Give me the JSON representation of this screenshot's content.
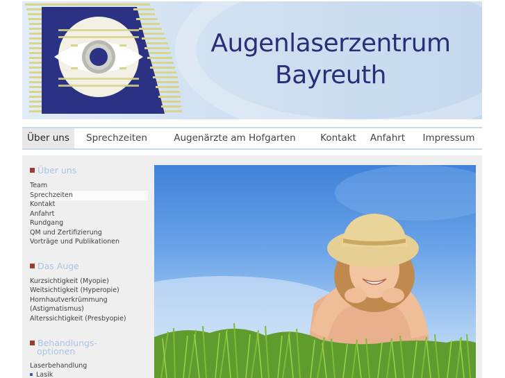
{
  "header": {
    "title_line1": "Augenlaserzentrum",
    "title_line2": "Bayreuth"
  },
  "nav": {
    "items": [
      "Über uns",
      "Sprechzeiten",
      "Augenärzte am Hofgarten",
      "Kontakt",
      "Anfahrt",
      "Impressum"
    ],
    "active": "Über uns"
  },
  "sidebar": {
    "sections": [
      {
        "title": "Über uns",
        "items": [
          "Team",
          "Sprechzeiten",
          "Kontakt",
          "Anfahrt",
          "Rundgang",
          "QM und Zertifizierung",
          "Vorträge und Publikationen"
        ]
      },
      {
        "title": "Das Auge",
        "items": [
          "Kurzsichtigkeit (Myopie)",
          "Weitsichtigkeit (Hyperopie)",
          "Hornhautverkrümmung",
          "(Astigmatismus)",
          "Alterssichtigkeit (Presbyopie)"
        ]
      },
      {
        "title_line1": "Behandlungs-",
        "title_line2": "optionen",
        "items": [
          "Laserbehandlung",
          "Lasik"
        ]
      }
    ]
  },
  "colors": {
    "logo_navy": "#2b3283",
    "logo_stripe": "#d8d48a",
    "title_color": "#2a2d78",
    "section_square": "#a03a2e",
    "section_title": "#a7c4e3",
    "nav_border": "#c7d9ec"
  }
}
